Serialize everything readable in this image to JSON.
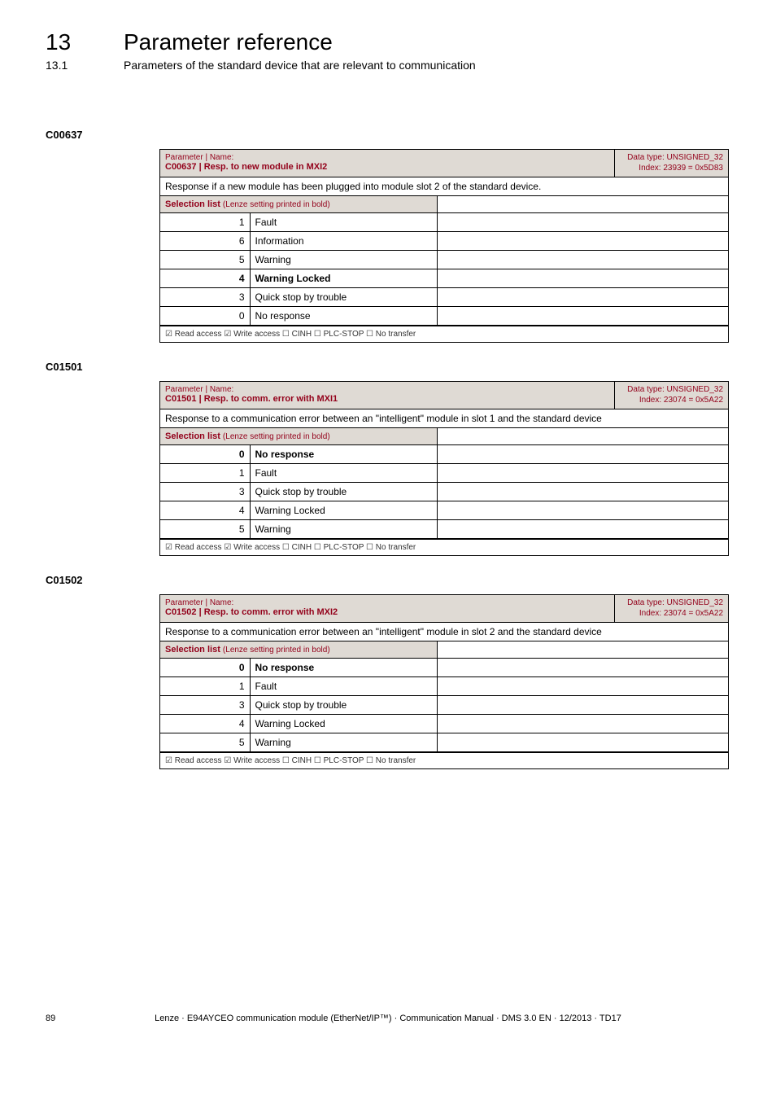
{
  "chapter": {
    "num": "13",
    "title": "Parameter reference"
  },
  "sub": {
    "num": "13.1",
    "title": "Parameters of the standard device that are relevant to communication"
  },
  "dashes": "_ _ _ _ _ _ _ _ _ _ _ _ _ _ _ _ _ _ _ _ _ _ _ _ _ _ _ _ _ _ _ _ _ _ _ _ _ _ _ _ _ _ _ _ _ _ _ _ _ _ _ _ _ _ _ _ _ _ _ _ _ _ _ _",
  "tables": [
    {
      "code": "C00637",
      "pn_label": "Parameter | Name:",
      "pname": "C00637 | Resp. to new module in MXI2",
      "dtype": "Data type: UNSIGNED_32",
      "index": "Index: 23939 = 0x5D83",
      "desc": "Response if a new module has been plugged into module slot 2 of the standard device.",
      "sel_header": "Selection list",
      "sel_header_sub": "(Lenze setting printed in bold)",
      "rows": [
        {
          "n": "1",
          "v": "Fault",
          "bold": false
        },
        {
          "n": "6",
          "v": "Information",
          "bold": false
        },
        {
          "n": "5",
          "v": "Warning",
          "bold": false
        },
        {
          "n": "4",
          "v": "Warning Locked",
          "bold": true
        },
        {
          "n": "3",
          "v": "Quick stop by trouble",
          "bold": false
        },
        {
          "n": "0",
          "v": "No response",
          "bold": false
        }
      ],
      "footer": "☑ Read access   ☑ Write access   ☐ CINH   ☐ PLC-STOP   ☐ No transfer"
    },
    {
      "code": "C01501",
      "pn_label": "Parameter | Name:",
      "pname": "C01501 | Resp. to comm. error with MXI1",
      "dtype": "Data type: UNSIGNED_32",
      "index": "Index: 23074 = 0x5A22",
      "desc": "Response to a communication error between an \"intelligent\" module in slot 1 and the standard device",
      "sel_header": "Selection list",
      "sel_header_sub": "(Lenze setting printed in bold)",
      "rows": [
        {
          "n": "0",
          "v": "No response",
          "bold": true
        },
        {
          "n": "1",
          "v": "Fault",
          "bold": false
        },
        {
          "n": "3",
          "v": "Quick stop by trouble",
          "bold": false
        },
        {
          "n": "4",
          "v": "Warning Locked",
          "bold": false
        },
        {
          "n": "5",
          "v": "Warning",
          "bold": false
        }
      ],
      "footer": "☑ Read access   ☑ Write access   ☐ CINH   ☐ PLC-STOP   ☐ No transfer"
    },
    {
      "code": "C01502",
      "pn_label": "Parameter | Name:",
      "pname": "C01502 | Resp. to comm. error with MXI2",
      "dtype": "Data type: UNSIGNED_32",
      "index": "Index: 23074 = 0x5A22",
      "desc": "Response to a communication error between an \"intelligent\" module in slot 2 and the standard device",
      "sel_header": "Selection list",
      "sel_header_sub": "(Lenze setting printed in bold)",
      "rows": [
        {
          "n": "0",
          "v": "No response",
          "bold": true
        },
        {
          "n": "1",
          "v": "Fault",
          "bold": false
        },
        {
          "n": "3",
          "v": "Quick stop by trouble",
          "bold": false
        },
        {
          "n": "4",
          "v": "Warning Locked",
          "bold": false
        },
        {
          "n": "5",
          "v": "Warning",
          "bold": false
        }
      ],
      "footer": "☑ Read access   ☑ Write access   ☐ CINH   ☐ PLC-STOP   ☐ No transfer"
    }
  ],
  "page_footer": {
    "left": "89",
    "center": "Lenze · E94AYCEO communication module (EtherNet/IP™) · Communication Manual · DMS 3.0 EN · 12/2013 · TD17"
  }
}
